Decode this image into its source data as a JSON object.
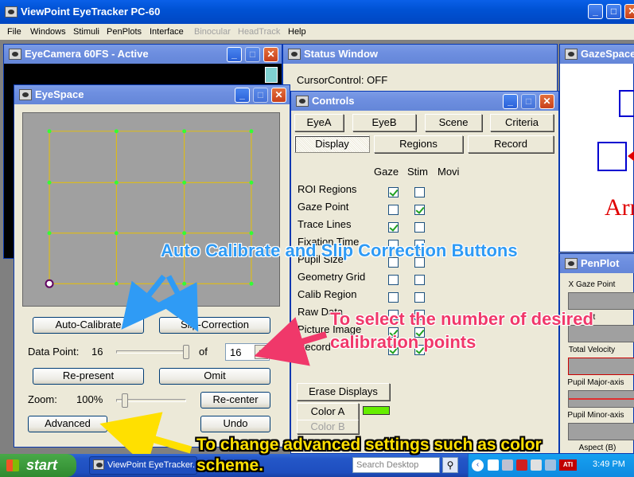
{
  "app": {
    "title": "ViewPoint EyeTracker PC-60",
    "menu": [
      "File",
      "Windows",
      "Stimuli",
      "PenPlots",
      "Interface",
      "Binocular",
      "HeadTrack",
      "Help"
    ],
    "menu_disabled": [
      "Binocular",
      "HeadTrack"
    ]
  },
  "eyecamera": {
    "title": "EyeCamera 60FS - Active"
  },
  "status": {
    "title": "Status Window",
    "text": "CursorControl: OFF"
  },
  "gazespace": {
    "title": "GazeSpace",
    "stim_text": "Arri"
  },
  "eyespace": {
    "title": "EyeSpace",
    "auto_calibrate": "Auto-Calibrate",
    "slip_correction": "Slip-Correction",
    "data_point_label": "Data Point:",
    "data_point_value": "16",
    "of_label": "of",
    "points_select": "16",
    "represent": "Re-present",
    "omit": "Omit",
    "zoom_label": "Zoom:",
    "zoom_value": "100%",
    "recenter": "Re-center",
    "advanced": "Advanced",
    "undo": "Undo"
  },
  "controls": {
    "title": "Controls",
    "tabs_row1": [
      "EyeA",
      "EyeB",
      "Scene",
      "Criteria"
    ],
    "tabs_row2": [
      "Display",
      "Regions",
      "Record"
    ],
    "col_headers": [
      "Gaze",
      "Stim",
      "Movi"
    ],
    "rows": [
      {
        "label": "ROI Regions",
        "gaze": true,
        "stim": false
      },
      {
        "label": "Gaze Point",
        "gaze": false,
        "stim": true
      },
      {
        "label": "Trace Lines",
        "gaze": true,
        "stim": false
      },
      {
        "label": "Fixation Time",
        "gaze": false,
        "stim": false
      },
      {
        "label": "Pupil Size",
        "gaze": false,
        "stim": false
      },
      {
        "label": "Geometry Grid",
        "gaze": false,
        "stim": false
      },
      {
        "label": "Calib Region",
        "gaze": false,
        "stim": false
      },
      {
        "label": "Raw Data",
        "gaze": false,
        "stim": false
      },
      {
        "label": "Picture Image",
        "gaze": true,
        "stim": true
      },
      {
        "label": "Record",
        "gaze": true,
        "stim": true
      }
    ],
    "erase": "Erase Displays",
    "color_a": "Color  A",
    "color_b": "Color  B",
    "color_a_swatch": "#66ee00"
  },
  "penplot": {
    "title": "PenPlot",
    "labels": [
      "X Gaze Point",
      "nt",
      "Total Velocity",
      "Pupil Major-axis",
      "Pupil Minor-axis",
      "Aspect (B)"
    ]
  },
  "annotations": {
    "auto_slip": "Auto Calibrate and Slip Correction Buttons",
    "select_line1": "To select the number of desired",
    "select_line2": "calibration points",
    "advanced_line1": "To change advanced settings such as color",
    "advanced_line2": "scheme."
  },
  "taskbar": {
    "start": "start",
    "task": "ViewPoint EyeTracker...",
    "search_placeholder": "Search Desktop",
    "clock": "3:49 PM"
  }
}
